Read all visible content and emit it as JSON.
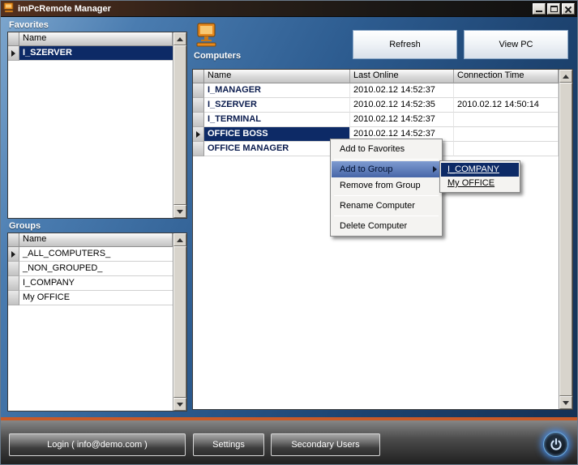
{
  "window": {
    "title": "imPcRemote Manager"
  },
  "panels": {
    "favorites": {
      "label": "Favorites",
      "column_header": "Name",
      "items": [
        {
          "name": "I_SZERVER",
          "selected": true
        }
      ]
    },
    "groups": {
      "label": "Groups",
      "column_header": "Name",
      "items": [
        {
          "name": "_ALL_COMPUTERS_"
        },
        {
          "name": "_NON_GROUPED_"
        },
        {
          "name": "I_COMPANY"
        },
        {
          "name": "My OFFICE"
        }
      ]
    }
  },
  "computers": {
    "label": "Computers",
    "refresh_button": "Refresh",
    "view_pc_button": "View PC",
    "columns": [
      "Name",
      "Last Online",
      "Connection Time"
    ],
    "rows": [
      {
        "name": "I_MANAGER",
        "last_online": "2010.02.12 14:52:37",
        "connection_time": ""
      },
      {
        "name": "I_SZERVER",
        "last_online": "2010.02.12 14:52:35",
        "connection_time": "2010.02.12 14:50:14"
      },
      {
        "name": "I_TERMINAL",
        "last_online": "2010.02.12 14:52:37",
        "connection_time": ""
      },
      {
        "name": "OFFICE BOSS",
        "last_online": "2010.02.12 14:52:37",
        "connection_time": "",
        "selected": true
      },
      {
        "name": "OFFICE MANAGER",
        "last_online": "",
        "connection_time": ""
      }
    ]
  },
  "context_menu": {
    "items": [
      {
        "label": "Add to Favorites"
      },
      {
        "label": "Add to Group",
        "highlighted": true,
        "has_submenu": true
      },
      {
        "label": "Remove from Group"
      },
      {
        "label": "Rename Computer"
      },
      {
        "label": "Delete Computer"
      }
    ],
    "submenu": {
      "items": [
        {
          "label": "I_COMPANY",
          "highlighted": true
        },
        {
          "label": "My OFFICE"
        }
      ]
    }
  },
  "footer": {
    "login_button": "Login ( info@demo.com )",
    "settings_button": "Settings",
    "secondary_users_button": "Secondary Users"
  },
  "colors": {
    "selection": "#0d2a66",
    "accent_orange": "#c85a28",
    "menu_highlight": "#4766a8"
  }
}
